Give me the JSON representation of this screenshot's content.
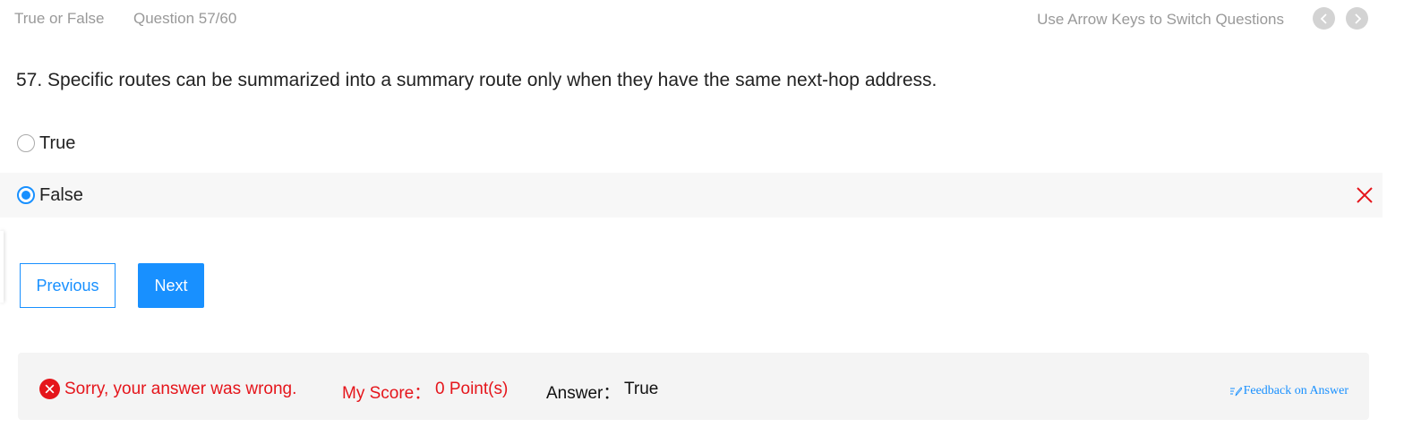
{
  "header": {
    "question_type": "True or False",
    "question_counter": "Question 57/60",
    "hint": "Use Arrow Keys to Switch Questions",
    "prev_icon": "chevron-left-icon",
    "next_icon": "chevron-right-icon"
  },
  "question": {
    "text": "57. Specific routes can be summarized into a summary route only when they have the same next-hop address.",
    "options": [
      {
        "label": "True",
        "selected": false
      },
      {
        "label": "False",
        "selected": true,
        "mark": "wrong-x-icon"
      }
    ]
  },
  "buttons": {
    "previous": "Previous",
    "next": "Next"
  },
  "result": {
    "icon": "error-circle-icon",
    "message": "Sorry, your answer was wrong.",
    "score_label": "My Score：",
    "score_value": "0 Point(s)",
    "answer_label": "Answer：",
    "answer_value": "True",
    "feedback_link": "Feedback on Answer",
    "feedback_icon": "edit-feedback-icon"
  },
  "colors": {
    "accent": "#1890ff",
    "error": "#e5151b",
    "muted": "#999999",
    "result_bg": "#f4f4f4"
  }
}
